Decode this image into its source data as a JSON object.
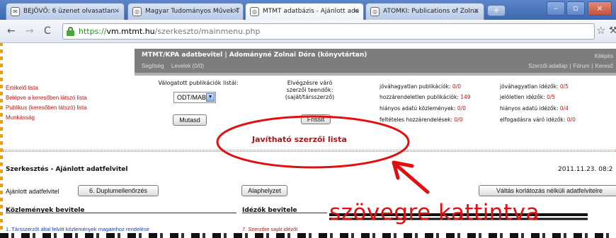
{
  "browser": {
    "tabs": [
      {
        "label": "BEJÖVŐ: 6 üzenet olvasatlan - ",
        "icon": "mail-icon",
        "active": false
      },
      {
        "label": "Magyar Tudományos Művek T",
        "icon": "page-icon",
        "active": false
      },
      {
        "label": "MTMT adatbázis - Ajánlott ada",
        "icon": "page-icon",
        "active": true
      },
      {
        "label": "ATOMKI: Publications of Zolna",
        "icon": "page-icon",
        "active": false
      }
    ],
    "url": {
      "scheme": "https://",
      "host": "vm.mtmt.hu",
      "path": "/szerkeszto/mainmenu.php"
    }
  },
  "sidebar": {
    "links": [
      {
        "label": "Értékelő lista"
      },
      {
        "label": "Belépve a keresőben látszó lista"
      },
      {
        "label": "Publikus (keresőben látszó) lista"
      },
      {
        "label": "Munkásság"
      }
    ]
  },
  "header": {
    "title": "MTMT/KPA adatbevitel | Adományné Zolnai Dóra (könyvtártan)",
    "links": [
      "Segítség",
      "Levelek (0/0)"
    ],
    "logout": "Kilépés",
    "right_links": [
      "Szerzői adatlap",
      "Fórum",
      "Kereső"
    ]
  },
  "main": {
    "publication_lists_title": "Válogatott publikációk listái:",
    "selected_list": "ODT/MAB",
    "show_button": "Mutasd",
    "pending_title_1": "Elvégzésre váró",
    "pending_title_2": "szerzői teendők:",
    "pending_title_3": "(saját/társszerző)",
    "refresh_button": "Frissít",
    "stats_left": [
      {
        "label": "jóváhagyatlan publikációk:",
        "value": "0/0"
      },
      {
        "label": "hozzárendeletlen publikációk:",
        "value": "149"
      },
      {
        "label": "hiányos adatú közlemények:",
        "value": "0/0"
      },
      {
        "label": "feltételes hozzárendelések:",
        "value": "0/0"
      }
    ],
    "stats_right": [
      {
        "label": "jóváhagyatlan idézők:",
        "value": "0/5"
      },
      {
        "label": "jelöletlen idézők:",
        "value": "0/5"
      },
      {
        "label": "hiányos adatú idézők:",
        "value": "0/4"
      },
      {
        "label": "elfogadásra váró idézők:",
        "value": "0/0"
      }
    ],
    "correctable_list": "Javítható szerzői lista"
  },
  "edit_section": {
    "title": "Szerkesztés - Ajánlott adatfelvitel",
    "datetime": "2011.11.23. 08:2",
    "recommended_label": "Ajánlott adatfelvitel",
    "duplicate_check_button": "6. Duplumellenőrzés",
    "reset_button": "Alaphelyzet",
    "switch_button": "Váltás korlátozás nélküli adatfelvitelre",
    "publications_title": "Közlemények bevitele",
    "citations_title": "Idézők bevitele",
    "publication_row": "1. Társszerzőt által felvitt közlemények magamhoz rendelése",
    "citation_row": "7. Szerzőre saját idézőt"
  },
  "annotation": {
    "text": "szövegre kattintva",
    "color": "#e01010"
  }
}
